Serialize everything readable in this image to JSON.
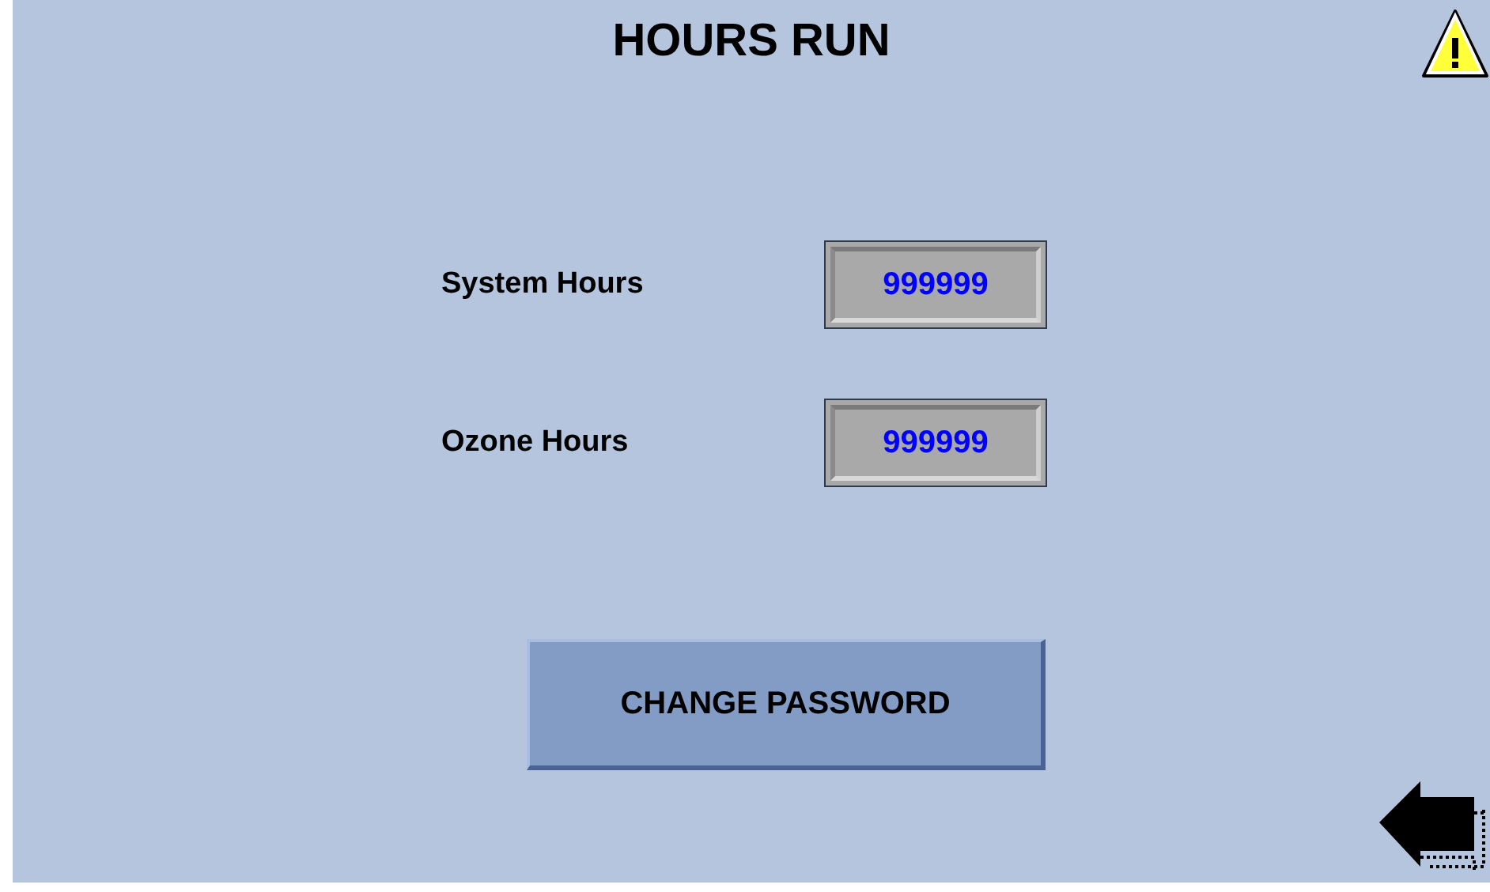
{
  "title": "HOURS RUN",
  "fields": [
    {
      "label": "System Hours",
      "value": "999999"
    },
    {
      "label": "Ozone Hours",
      "value": "999999"
    }
  ],
  "button": "CHANGE PASSWORD"
}
